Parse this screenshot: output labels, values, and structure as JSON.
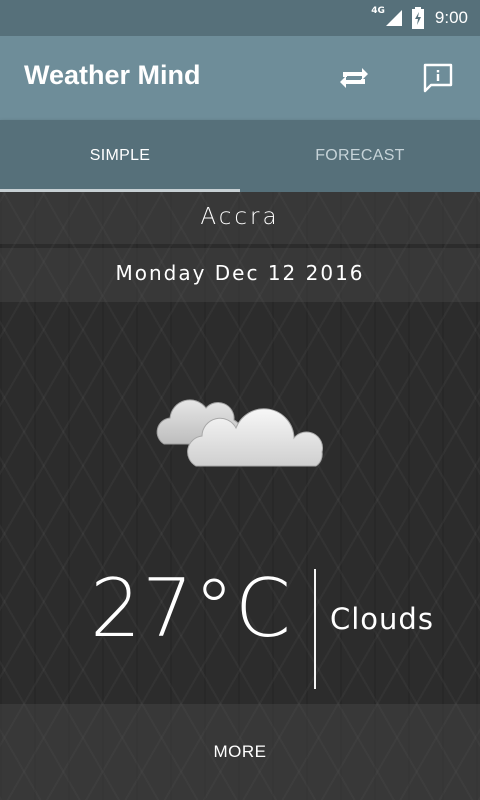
{
  "status_bar": {
    "network_label": "4G",
    "time": "9:00",
    "icons": [
      "signal-icon",
      "battery-icon"
    ]
  },
  "app_bar": {
    "title": "Weather Mind",
    "actions": [
      {
        "name": "refresh",
        "icon": "repeat-icon"
      },
      {
        "name": "info",
        "icon": "feedback-info-icon"
      }
    ]
  },
  "tabs": [
    {
      "label": "SIMPLE",
      "selected": true
    },
    {
      "label": "FORECAST",
      "selected": false
    }
  ],
  "weather": {
    "city": "Accra",
    "date": "Monday Dec 12 2016",
    "icon": "clouds-icon",
    "temperature": "27°C",
    "condition": "Clouds"
  },
  "more_label": "MORE",
  "colors": {
    "status_bar": "#56707a",
    "app_bar": "#6e8d99",
    "tab_bar": "#56707a",
    "background": "#2c2c2c"
  }
}
